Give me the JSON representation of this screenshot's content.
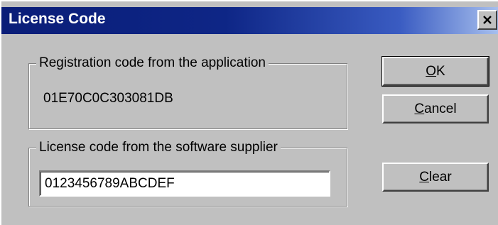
{
  "window": {
    "title": "License Code"
  },
  "registration": {
    "legend": "Registration code from the application",
    "code": "01E70C0C303081DB"
  },
  "license": {
    "legend": "License code from the software supplier",
    "value": "0123456789ABCDEF"
  },
  "buttons": {
    "ok": {
      "mnemonic": "O",
      "rest": "K"
    },
    "cancel": {
      "mnemonic": "C",
      "rest": "ancel"
    },
    "clear": {
      "mnemonic": "C",
      "rest": "lear"
    }
  },
  "icons": {
    "close": "close-icon"
  }
}
